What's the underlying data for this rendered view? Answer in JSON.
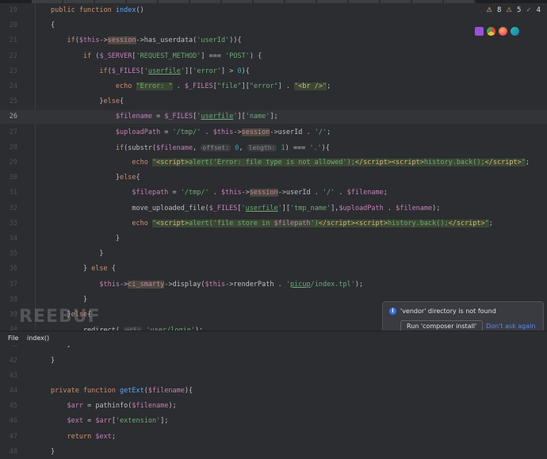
{
  "inspections": {
    "warnings": "8",
    "others": "5",
    "ok": "4"
  },
  "status": {
    "file_label": "File",
    "method": "index()"
  },
  "notification": {
    "message": "'vendor' directory is not found",
    "primary_button": "Run 'composer install'",
    "secondary_link": "Don't ask again"
  },
  "watermark": "REEBUF",
  "lines": [
    {
      "n": "19",
      "html": "<span class='kw'>public function </span><span class='fn'>index</span>()"
    },
    {
      "n": "20",
      "html": "{"
    },
    {
      "n": "21",
      "html": "    <span class='kw'>if</span>(<span class='vr'>$this</span>-><span class='sessionhl'>session</span>->has_userdata(<span class='st'>'userId'</span>)){"
    },
    {
      "n": "22",
      "html": "        <span class='kw'>if</span> (<span class='vr'>$_SERVER</span>[<span class='st'>'REQUEST_METHOD'</span>] === <span class='st'>'POST'</span>) {"
    },
    {
      "n": "23",
      "html": "            <span class='kw'>if</span>(<span class='vr'>$_FILES</span>[<span class='st'>'<u>userfile</u>'</span>][<span class='st'>'error'</span>] > <span class='num'>0</span>){"
    },
    {
      "n": "24",
      "html": "                <span class='kw'>echo</span> <span class='st hl'>\"Error: \"</span> . <span class='vr'>$_FILES</span>[<span class='st'>\"file\"</span>][<span class='st'>\"error\"</span>] . <span class='st hl'>\"<span class='htmltag'>&lt;br /&gt;</span>\"</span>;"
    },
    {
      "n": "25",
      "html": "            }<span class='kw'>else</span>{"
    },
    {
      "n": "26",
      "html": "                <span class='vr'>$filename</span> = <span class='vr'>$_FILES</span>[<span class='st'>'<u>userfile</u>'</span>][<span class='st'>'name'</span>];",
      "cur": true
    },
    {
      "n": "27",
      "html": "                <span class='vr'>$uploadPath</span> = <span class='st'>'/tmp/'</span> . <span class='vr'>$this</span>-><span class='sessionhl'>session</span>->userId . <span class='st'>'/'</span>;"
    },
    {
      "n": "28",
      "html": "                <span class='kw'>if</span>(substr(<span class='vr'>$filename</span>, <span class='hint'>offset:</span> <span class='num'>0</span>, <span class='hint'>length:</span> <span class='num'>1</span>) === <span class='st'>'.'</span>){"
    },
    {
      "n": "29",
      "html": "                    <span class='kw'>echo</span> <span class='st hl'>\"<span class='htmltag'>&lt;script&gt;</span>alert('Error: file type is not allowed');<span class='htmltag'>&lt;/script&gt;&lt;script&gt;</span>history.back();<span class='htmltag'>&lt;/script&gt;</span>\"</span>;"
    },
    {
      "n": "30",
      "html": "                }<span class='kw'>else</span>{"
    },
    {
      "n": "31",
      "html": "                    <span class='vr'>$filepath</span> = <span class='st'>'/tmp/'</span> . <span class='vr'>$this</span>-><span class='sessionhl'>session</span>->userId . <span class='st'>'/'</span> . <span class='vr'>$filename</span>;"
    },
    {
      "n": "32",
      "html": "                    move_uploaded_file(<span class='vr'>$_FILES</span>[<span class='st'>'<u>userfile</u>'</span>][<span class='st'>'tmp_name'</span>],<span class='vr'>$uploadPath</span> . <span class='vr'>$filename</span>);"
    },
    {
      "n": "33",
      "html": "                    <span class='kw'>echo</span> <span class='st hl'>\"<span class='htmltag'>&lt;script&gt;</span>alert('file store in <span class='vr'>$filepath</span>')<span class='htmltag'>&lt;/script&gt;&lt;script&gt;</span>history.back();<span class='htmltag'>&lt;/script&gt;</span>\"</span>;"
    },
    {
      "n": "34",
      "html": "                }"
    },
    {
      "n": "35",
      "html": "            }"
    },
    {
      "n": "36",
      "html": "        } <span class='kw'>else</span> {"
    },
    {
      "n": "37",
      "html": "            <span class='vr'>$this</span>-><span class='sessionhl'>ci_smarty</span>->display(<span class='vr'>$this</span>->renderPath . <span class='st'>'<u>picup</u>/index.tpl'</span>);"
    },
    {
      "n": "38",
      "html": "        }"
    },
    {
      "n": "39",
      "html": "    }<span class='kw'>else</span>{"
    },
    {
      "n": "40",
      "html": "        redirect( <span class='hint'>uri:</span> <span class='st'>'user/login'</span>);"
    },
    {
      "n": "41",
      "html": "    }"
    },
    {
      "n": "42",
      "html": "}"
    },
    {
      "n": "43",
      "html": ""
    },
    {
      "n": "44",
      "html": "<span class='kw'>private function </span><span class='fn'>getExt</span>(<span class='vr'>$filename</span>){"
    },
    {
      "n": "45",
      "html": "    <span class='vr'>$arr</span> = pathinfo(<span class='vr'>$filename</span>);"
    },
    {
      "n": "46",
      "html": "    <span class='vr'>$ext</span> = <span class='vr'>$arr</span>[<span class='st'>'extension'</span>];"
    },
    {
      "n": "47",
      "html": "    <span class='kw'>return</span> <span class='vr'>$ext</span>;"
    },
    {
      "n": "48",
      "html": "}"
    }
  ]
}
